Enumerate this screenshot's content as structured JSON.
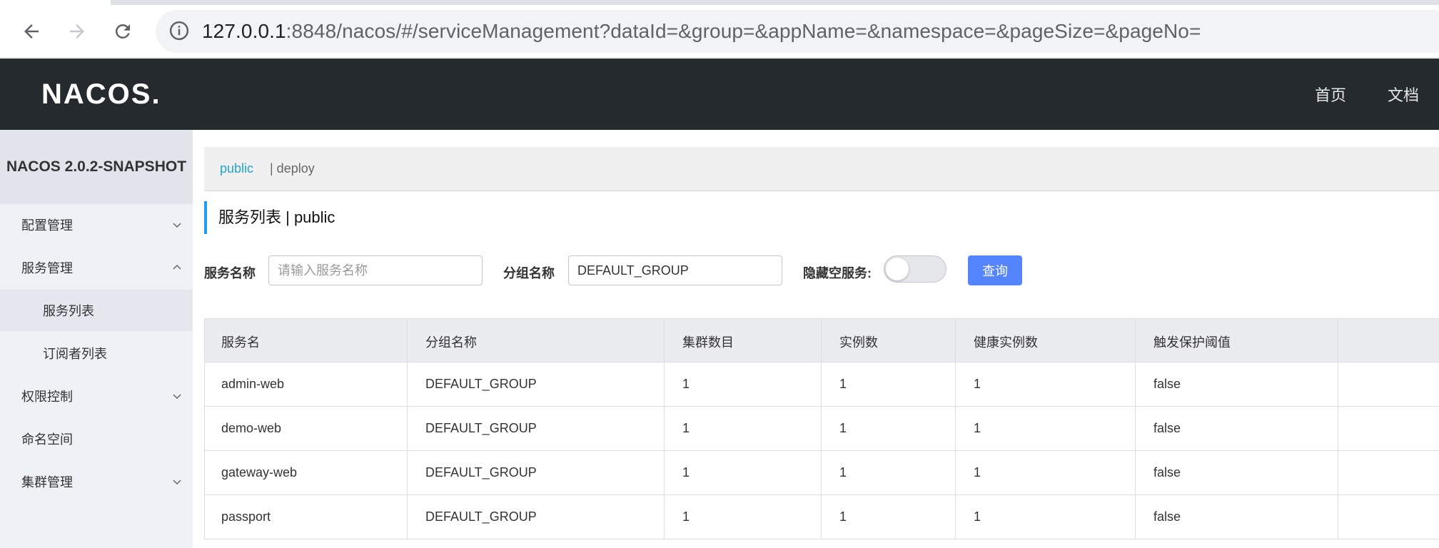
{
  "browser": {
    "url_host": "127.0.0.1",
    "url_rest": ":8848/nacos/#/serviceManagement?dataId=&group=&appName=&namespace=&pageSize=&pageNo="
  },
  "header": {
    "logo_text": "NACOS.",
    "links": [
      "首页",
      "文档"
    ]
  },
  "sidebar": {
    "title": "NACOS 2.0.2-SNAPSHOT",
    "items": [
      {
        "label": "配置管理",
        "expanded": false
      },
      {
        "label": "服务管理",
        "expanded": true
      },
      {
        "label": "服务列表",
        "sub": true,
        "active": true
      },
      {
        "label": "订阅者列表",
        "sub": true
      },
      {
        "label": "权限控制",
        "expanded": false
      },
      {
        "label": "命名空间"
      },
      {
        "label": "集群管理",
        "expanded": false
      }
    ]
  },
  "namespace_bar": {
    "active": "public",
    "other": "| deploy"
  },
  "page_title": "服务列表  |  public",
  "filters": {
    "service_name_label": "服务名称",
    "service_name_placeholder": "请输入服务名称",
    "service_name_value": "",
    "group_label": "分组名称",
    "group_value": "DEFAULT_GROUP",
    "hide_empty_label": "隐藏空服务:",
    "hide_empty_on": false,
    "query_button": "查询"
  },
  "table": {
    "columns": [
      "服务名",
      "分组名称",
      "集群数目",
      "实例数",
      "健康实例数",
      "触发保护阈值"
    ],
    "rows": [
      [
        "admin-web",
        "DEFAULT_GROUP",
        "1",
        "1",
        "1",
        "false"
      ],
      [
        "demo-web",
        "DEFAULT_GROUP",
        "1",
        "1",
        "1",
        "false"
      ],
      [
        "gateway-web",
        "DEFAULT_GROUP",
        "1",
        "1",
        "1",
        "false"
      ],
      [
        "passport",
        "DEFAULT_GROUP",
        "1",
        "1",
        "1",
        "false"
      ]
    ]
  },
  "colors": {
    "header_bg": "#252a2f",
    "sidebar_bg": "#eef1f6",
    "accent_blue": "#5584ff",
    "link_blue": "#1fa3d0"
  }
}
